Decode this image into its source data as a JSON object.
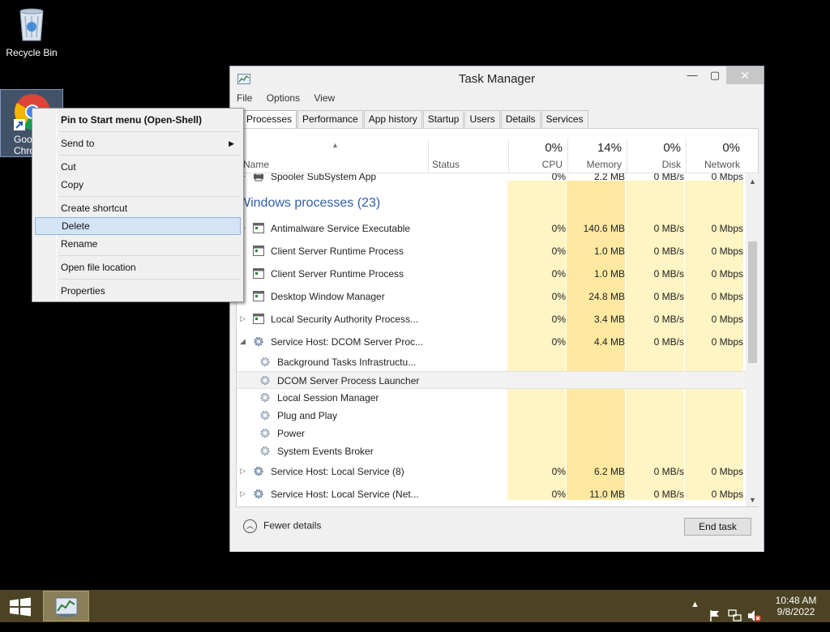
{
  "desktop": {
    "recycle_bin": "Recycle Bin",
    "chrome_label_line1": "Goo",
    "chrome_label_line2": "Chro"
  },
  "task_manager": {
    "title": "Task Manager",
    "menu": [
      "File",
      "Options",
      "View"
    ],
    "tabs": [
      "Processes",
      "Performance",
      "App history",
      "Startup",
      "Users",
      "Details",
      "Services"
    ],
    "active_tab": "Processes",
    "columns": {
      "name": "Name",
      "status": "Status",
      "cpu_pct": "0%",
      "cpu": "CPU",
      "mem_pct": "14%",
      "mem": "Memory",
      "disk_pct": "0%",
      "disk": "Disk",
      "net_pct": "0%",
      "net": "Network"
    },
    "top_partial_row": {
      "name": "Spooler SubSystem App",
      "cpu": "0%",
      "mem": "2.2 MB",
      "disk": "0 MB/s",
      "net": "0 Mbps"
    },
    "group_heading": "Windows processes (23)",
    "rows": [
      {
        "name": "Antimalware Service Executable",
        "cpu": "0%",
        "mem": "140.6 MB",
        "disk": "0 MB/s",
        "net": "0 Mbps",
        "expand": "collapsed",
        "icon": "app-window-icon"
      },
      {
        "name": "Client Server Runtime Process",
        "cpu": "0%",
        "mem": "1.0 MB",
        "disk": "0 MB/s",
        "net": "0 Mbps",
        "expand": "none",
        "icon": "app-window-icon"
      },
      {
        "name": "Client Server Runtime Process",
        "cpu": "0%",
        "mem": "1.0 MB",
        "disk": "0 MB/s",
        "net": "0 Mbps",
        "expand": "none",
        "icon": "app-window-icon"
      },
      {
        "name": "Desktop Window Manager",
        "cpu": "0%",
        "mem": "24.8 MB",
        "disk": "0 MB/s",
        "net": "0 Mbps",
        "expand": "none",
        "icon": "app-window-icon"
      },
      {
        "name": "Local Security Authority Process...",
        "cpu": "0%",
        "mem": "3.4 MB",
        "disk": "0 MB/s",
        "net": "0 Mbps",
        "expand": "collapsed",
        "icon": "app-window-icon"
      },
      {
        "name": "Service Host: DCOM Server Proc...",
        "cpu": "0%",
        "mem": "4.4 MB",
        "disk": "0 MB/s",
        "net": "0 Mbps",
        "expand": "expanded",
        "icon": "gear-icon"
      }
    ],
    "children": [
      "Background Tasks Infrastructu...",
      "DCOM Server Process Launcher",
      "Local Session Manager",
      "Plug and Play",
      "Power",
      "System Events Broker"
    ],
    "selected_child": "DCOM Server Process Launcher",
    "rows_after": [
      {
        "name": "Service Host: Local Service (8)",
        "cpu": "0%",
        "mem": "6.2 MB",
        "disk": "0 MB/s",
        "net": "0 Mbps",
        "expand": "collapsed",
        "icon": "gear-icon"
      },
      {
        "name": "Service Host: Local Service (Net...",
        "cpu": "0%",
        "mem": "11.0 MB",
        "disk": "0 MB/s",
        "net": "0 Mbps",
        "expand": "collapsed",
        "icon": "gear-icon"
      }
    ],
    "fewer_details": "Fewer details",
    "end_task": "End task"
  },
  "context_menu": {
    "items": [
      {
        "label": "Pin to Start menu (Open-Shell)",
        "bold": true
      },
      {
        "label": "Send to",
        "submenu": true
      },
      {
        "label": "Cut"
      },
      {
        "label": "Copy"
      },
      {
        "label": "Create shortcut"
      },
      {
        "label": "Delete",
        "highlighted": true
      },
      {
        "label": "Rename"
      },
      {
        "label": "Open file location"
      },
      {
        "label": "Properties"
      }
    ]
  },
  "taskbar": {
    "time": "10:48 AM",
    "date": "9/8/2022"
  },
  "colors": {
    "taskbar": "#4b4323",
    "group_heading": "#2f5fa9",
    "heat_light": "#fff4c4",
    "heat_dark": "#ffe9a0",
    "menu_highlight": "#d4e4f7"
  }
}
